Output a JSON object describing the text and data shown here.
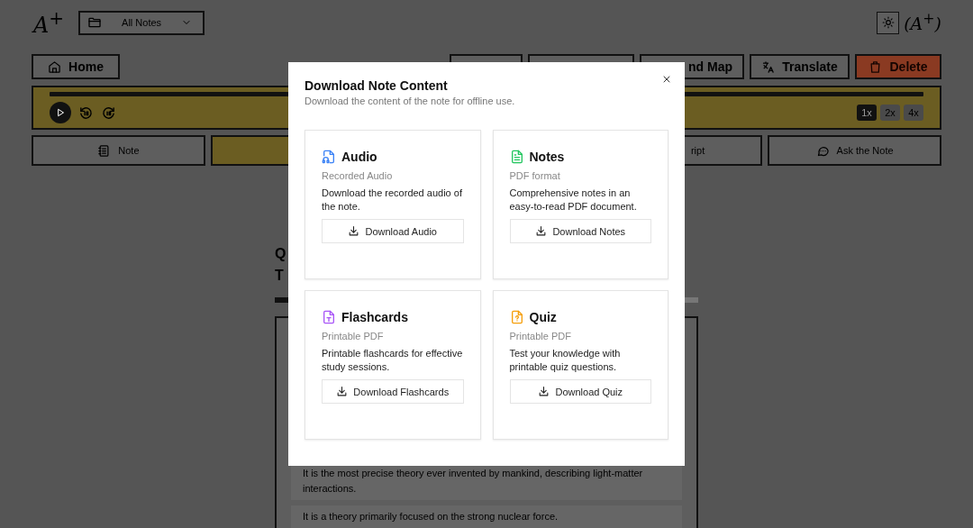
{
  "header": {
    "logo": "A$^{+}$",
    "folder_select": "All Notes",
    "brand_mark": "(A$^{+}$)"
  },
  "toolbar": [
    {
      "kind": "home",
      "label": "Home"
    },
    {
      "kind": "covered"
    },
    {
      "kind": "covered"
    },
    {
      "kind": "partial",
      "label": "nd Map"
    },
    {
      "kind": "translate",
      "label": "Translate"
    },
    {
      "kind": "delete",
      "label": "Delete"
    }
  ],
  "player": {
    "speeds": [
      {
        "label": "1x",
        "selected": true
      },
      {
        "label": "2x",
        "selected": false
      },
      {
        "label": "4x",
        "selected": false
      }
    ]
  },
  "tabs": [
    {
      "kind": "note",
      "label": "Note",
      "selected": false
    },
    {
      "kind": "covered",
      "selected": true
    },
    {
      "kind": "partial",
      "label": "ript",
      "selected": false
    },
    {
      "kind": "ask",
      "label": "Ask the Note",
      "selected": false
    }
  ],
  "quiz": {
    "title_lines": [
      "Q",
      "T"
    ],
    "options": [
      "It is the most precise theory ever invented by mankind, describing light-matter interactions.",
      "It is a theory primarily focused on the strong nuclear force."
    ]
  },
  "modal": {
    "title": "Download Note Content",
    "subtitle": "Download the content of the note for offline use.",
    "cards": [
      {
        "kind": "audio",
        "title": "Audio",
        "format": "Recorded Audio",
        "description": "Download the recorded audio of the note.",
        "button": "Download Audio"
      },
      {
        "kind": "notes",
        "title": "Notes",
        "format": "PDF format",
        "description": "Comprehensive notes in an easy-to-read PDF document.",
        "button": "Download Notes"
      },
      {
        "kind": "flashcards",
        "title": "Flashcards",
        "format": "Printable PDF",
        "description": "Printable flashcards for effective study sessions.",
        "button": "Download Flashcards"
      },
      {
        "kind": "quiz",
        "title": "Quiz",
        "format": "Printable PDF",
        "description": "Test your knowledge with printable quiz questions.",
        "button": "Download Quiz"
      }
    ]
  }
}
